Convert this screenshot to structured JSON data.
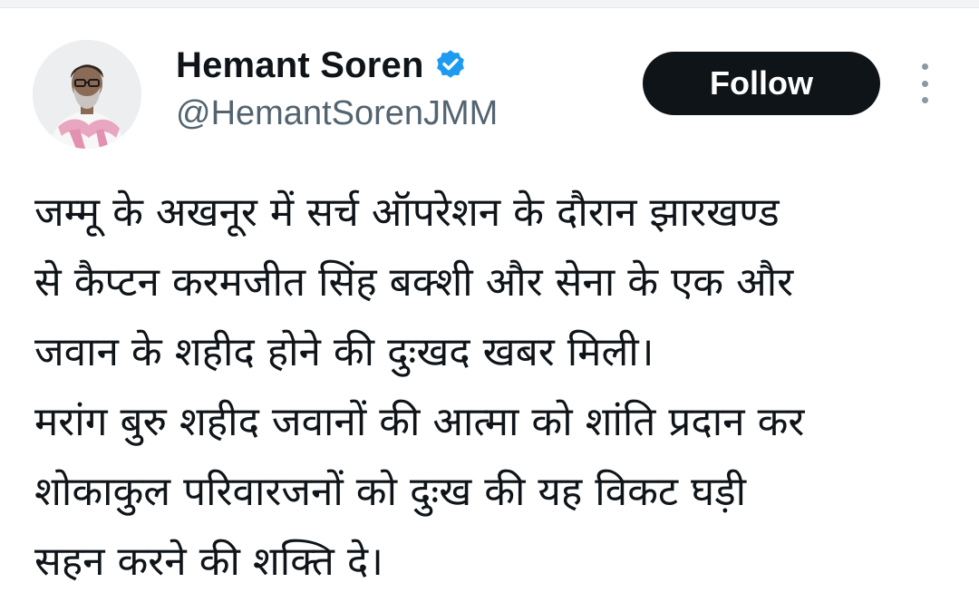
{
  "author": {
    "display_name": "Hemant Soren",
    "handle": "@HemantSorenJMM",
    "verified": true,
    "verified_icon": "verified-badge-icon",
    "avatar": "profile-photo"
  },
  "actions": {
    "follow_label": "Follow",
    "more_icon": "vertical-ellipsis-icon"
  },
  "tweet": {
    "lines": [
      "जम्मू के अखनूर में सर्च ऑपरेशन के दौरान झारखण्ड",
      "से कैप्टन करमजीत सिंह बक्शी और सेना के एक और",
      "जवान के शहीद होने की दुःखद खबर मिली।",
      "मरांग बुरु शहीद जवानों की आत्मा को शांति प्रदान कर",
      "शोकाकुल परिवारजनों को दुःख की यह विकट घड़ी",
      "सहन करने की शक्ति दे।"
    ]
  },
  "colors": {
    "text_primary": "#0f1419",
    "text_secondary": "#536471",
    "verified_blue": "#1d9bf0",
    "button_bg": "#0f1419",
    "button_text": "#ffffff"
  }
}
